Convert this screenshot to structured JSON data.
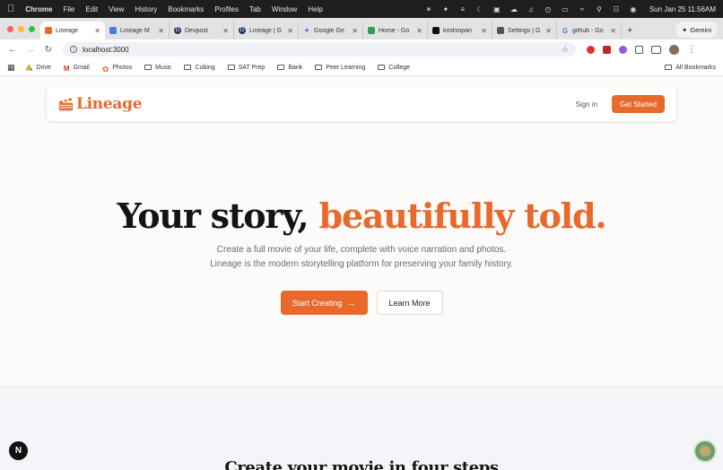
{
  "menubar": {
    "app": "Chrome",
    "menus": [
      "File",
      "Edit",
      "View",
      "History",
      "Bookmarks",
      "Profiles",
      "Tab",
      "Window",
      "Help"
    ],
    "clock": "Sun Jan 25  11:56AM"
  },
  "tabs": [
    {
      "label": "Lineage",
      "active": true,
      "color": "#e8692b"
    },
    {
      "label": "Lineage M",
      "color": "#4a7fe0"
    },
    {
      "label": "Devpost",
      "color": "#1f3a5a"
    },
    {
      "label": "Lineage | G",
      "color": "#1f3a5a"
    },
    {
      "label": "Google Ge",
      "color": "#4a7fe0"
    },
    {
      "label": "Home - Go",
      "color": "#2f9e5a"
    },
    {
      "label": "krishinpari",
      "color": "#111111"
    },
    {
      "label": "Settings | G",
      "color": "#555555"
    },
    {
      "label": "github - Go",
      "color": "#4a7fe0"
    }
  ],
  "gemini_label": "Gemini",
  "address": {
    "url": "localhost:3000"
  },
  "bookmarks": [
    {
      "label": "Drive",
      "icon": "drive-icon"
    },
    {
      "label": "Gmail",
      "icon": "gmail-icon"
    },
    {
      "label": "Photos",
      "icon": "photos-icon"
    },
    {
      "label": "Music",
      "icon": "folder-icon"
    },
    {
      "label": "Cubing",
      "icon": "folder-icon"
    },
    {
      "label": "SAT Prep",
      "icon": "folder-icon"
    },
    {
      "label": "Bank",
      "icon": "folder-icon"
    },
    {
      "label": "Peer Learning",
      "icon": "folder-icon"
    },
    {
      "label": "College",
      "icon": "folder-icon"
    }
  ],
  "all_bookmarks": "All Bookmarks",
  "site": {
    "logo": "Lineage",
    "signin": "Sign in",
    "get_started": "Get Started",
    "hero": {
      "title_plain": "Your story,",
      "title_accent": "beautifully told.",
      "subtitle_line1": "Create a full movie of your life, complete with voice narration and photos.",
      "subtitle_line2": "Lineage is the modern storytelling platform for preserving your family history.",
      "primary_cta": "Start Creating",
      "secondary_cta": "Learn More"
    },
    "section2_title": "Create your movie in four steps",
    "next_badge": "N"
  },
  "colors": {
    "accent": "#e8692b",
    "ink": "#141414"
  }
}
